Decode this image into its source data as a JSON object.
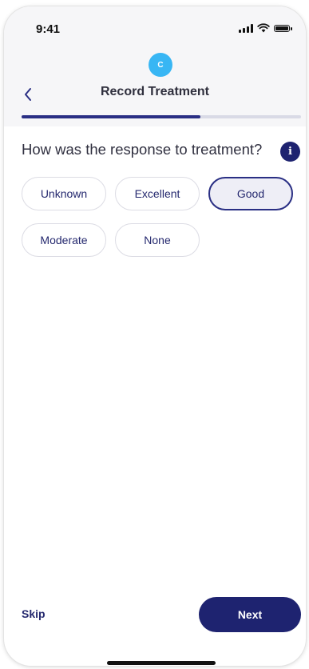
{
  "status_bar": {
    "time": "9:41",
    "icons": [
      "signal-icon",
      "wifi-icon",
      "battery-icon"
    ]
  },
  "header": {
    "avatar_initial": "C",
    "title": "Record Treatment",
    "back_icon": "chevron-left-icon"
  },
  "progress": {
    "fraction": 0.64
  },
  "question": {
    "text": "How was the response to treatment?",
    "info_label": "i"
  },
  "options": [
    {
      "label": "Unknown",
      "selected": false
    },
    {
      "label": "Excellent",
      "selected": false
    },
    {
      "label": "Good",
      "selected": true
    },
    {
      "label": "Moderate",
      "selected": false
    },
    {
      "label": "None",
      "selected": false
    }
  ],
  "footer": {
    "skip_label": "Skip",
    "next_label": "Next"
  },
  "colors": {
    "primary": "#1e2370",
    "accent": "#38b6f4",
    "progress_track": "#d9dae6"
  }
}
